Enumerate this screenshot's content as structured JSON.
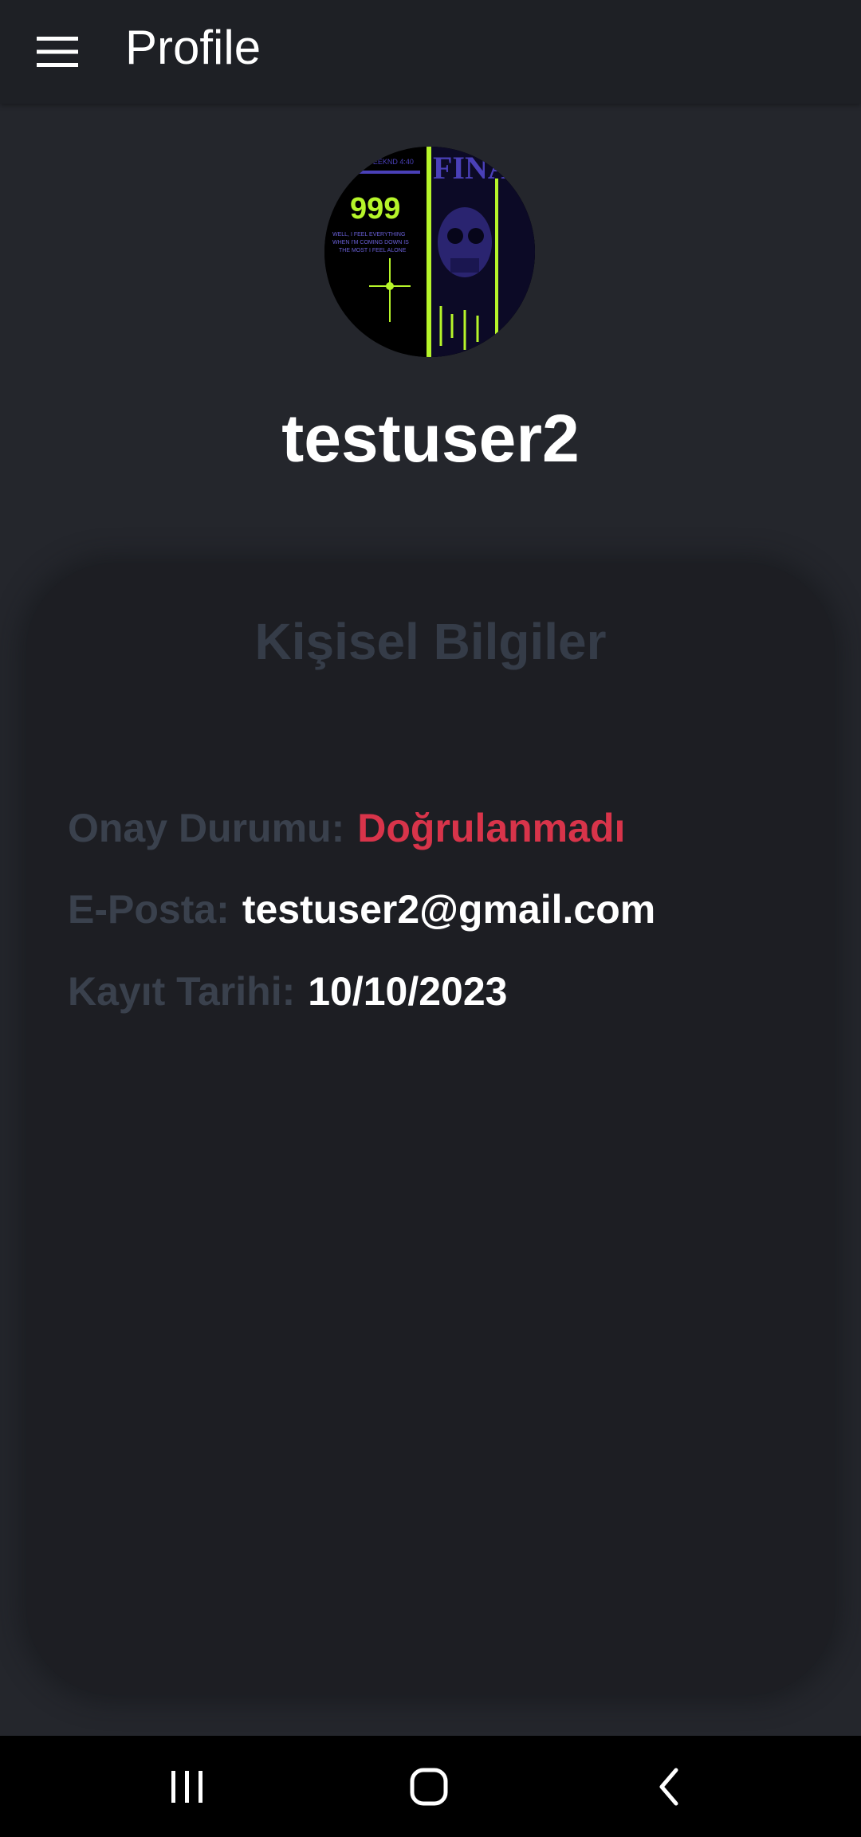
{
  "appbar": {
    "title": "Profile",
    "menu_icon": "hamburger-menu-icon"
  },
  "profile": {
    "username": "testuser2",
    "avatar": {
      "art_text_brand": "FINAL",
      "art_text_number": "999",
      "art_lines": [
        "WELL, I FEEL EVERYTHING",
        "WHEN I'M COMING DOWN IS",
        "THE MOST I FEEL ALONE"
      ]
    }
  },
  "personal_info": {
    "title": "Kişisel Bilgiler",
    "rows": [
      {
        "label": "Onay Durumu:",
        "value": "Doğrulanmadı",
        "status_color": "#d8344a"
      },
      {
        "label": "E-Posta:",
        "value": "testuser2@gmail.com"
      },
      {
        "label": "Kayıt Tarihi:",
        "value": "10/10/2023"
      }
    ]
  },
  "system_nav": {
    "recents_icon": "recent-apps-icon",
    "home_icon": "home-icon",
    "back_icon": "back-icon"
  },
  "colors": {
    "background": "#24262c",
    "appbar": "#1e2025",
    "card": "#1d1e23",
    "muted_label": "#3a414d",
    "alert": "#d8344a",
    "avatar_accent": "#b6f52a",
    "avatar_purple": "#4a40b8"
  }
}
